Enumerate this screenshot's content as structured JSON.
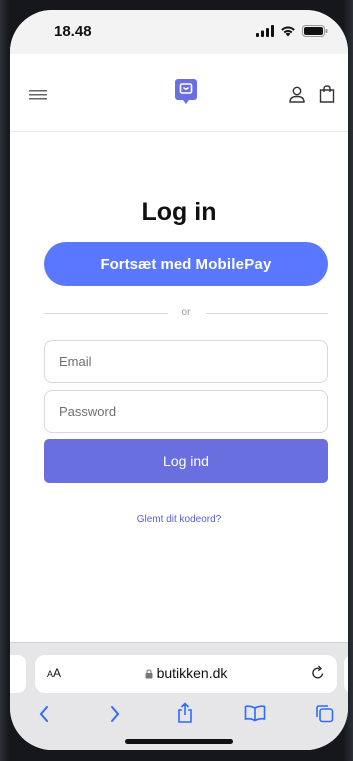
{
  "status_bar": {
    "time": "18.48"
  },
  "header": {
    "menu_icon": "hamburger-menu-icon",
    "logo_icon": "shop-logo-icon",
    "account_icon": "account-icon",
    "cart_icon": "shopping-bag-icon"
  },
  "login": {
    "title": "Log in",
    "mobilepay_prefix": "Fortsæt med ",
    "mobilepay_brand": "MobilePay",
    "divider": "or",
    "email_placeholder": "Email",
    "password_placeholder": "Password",
    "submit_label": "Log ind",
    "forgot_link": "Glemt dit kodeord?"
  },
  "browser": {
    "text_size_label_small": "A",
    "text_size_label_large": "A",
    "url": "butikken.dk",
    "reload_icon": "reload-icon",
    "nav": [
      "back-icon",
      "forward-icon",
      "share-icon",
      "bookmarks-icon",
      "tabs-icon"
    ]
  },
  "colors": {
    "accent": "#5a78ff",
    "button": "#6a6fe0",
    "link": "#5a5fd6"
  }
}
